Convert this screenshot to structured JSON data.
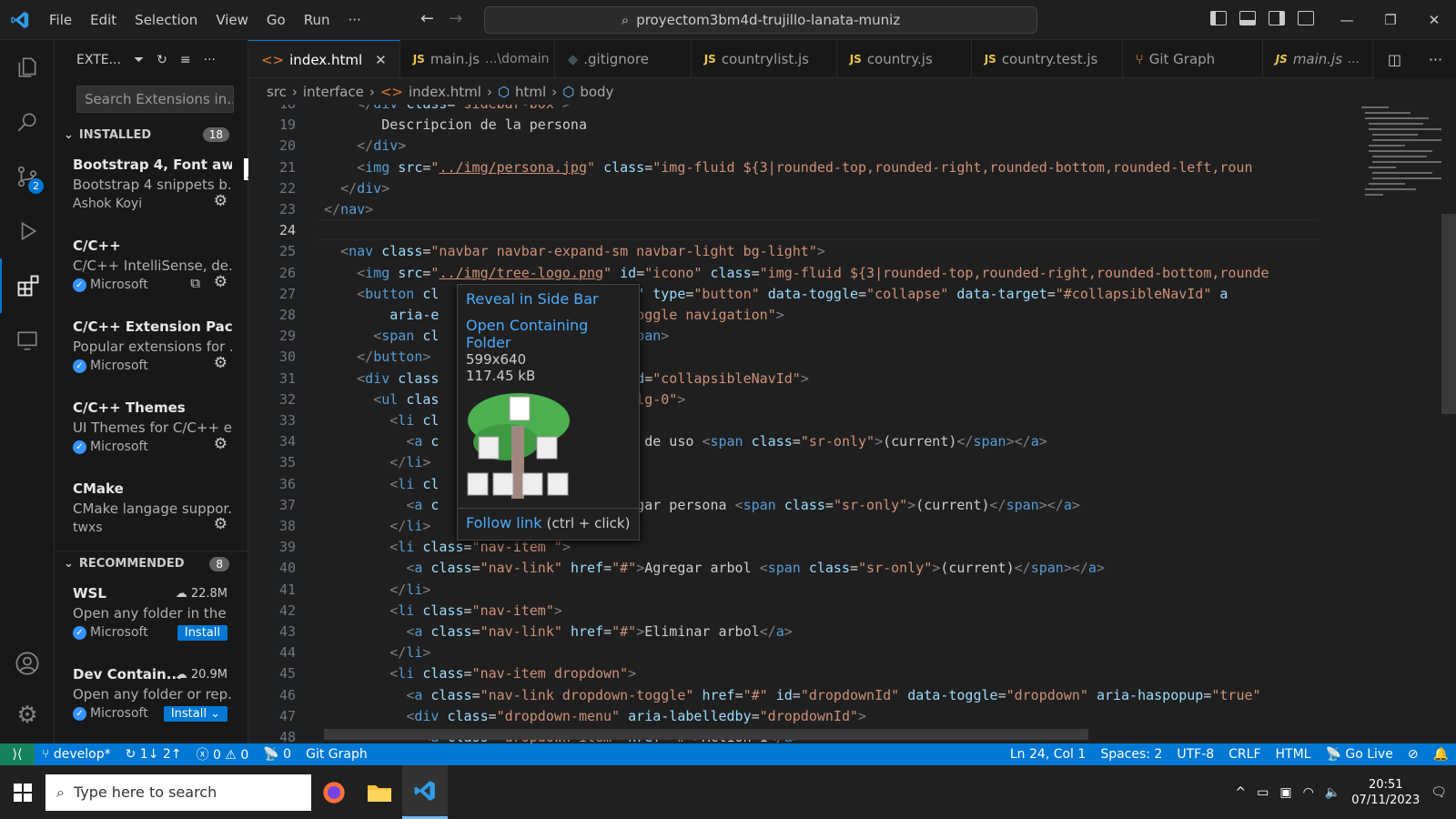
{
  "menu": [
    "File",
    "Edit",
    "Selection",
    "View",
    "Go",
    "Run",
    "···"
  ],
  "command_center": "proyectom3bm4d-trujillo-lanata-muniz",
  "sidebar": {
    "title": "EXTE...",
    "search_placeholder": "Search Extensions in...",
    "installed_label": "INSTALLED",
    "installed_count": "18",
    "recommended_label": "RECOMMENDED",
    "recommended_count": "8",
    "installed": [
      {
        "name": "Bootstrap 4, Font aw...",
        "desc": "Bootstrap 4 snippets b...",
        "publisher": "Ashok Koyi"
      },
      {
        "name": "C/C++",
        "desc": "C/C++ IntelliSense, de...",
        "publisher": "Microsoft"
      },
      {
        "name": "C/C++ Extension Pack",
        "desc": "Popular extensions for ...",
        "publisher": "Microsoft"
      },
      {
        "name": "C/C++ Themes",
        "desc": "UI Themes for C/C++ e...",
        "publisher": "Microsoft"
      },
      {
        "name": "CMake",
        "desc": "CMake langage suppor...",
        "publisher": "twxs"
      }
    ],
    "recommended": [
      {
        "name": "WSL",
        "desc": "Open any folder in the ...",
        "publisher": "Microsoft",
        "downloads": "22.8M",
        "action": "Install"
      },
      {
        "name": "Dev Contain...",
        "desc": "Open any folder or rep...",
        "publisher": "Microsoft",
        "downloads": "20.9M",
        "action": "Install"
      }
    ]
  },
  "source_control_badge": "2",
  "tabs": [
    {
      "label": "index.html",
      "desc": "",
      "kind": "html"
    },
    {
      "label": "main.js",
      "desc": "...\\domain",
      "kind": "js"
    },
    {
      "label": ".gitignore",
      "desc": "",
      "kind": "git"
    },
    {
      "label": "countrylist.js",
      "desc": "",
      "kind": "js"
    },
    {
      "label": "country.js",
      "desc": "",
      "kind": "js"
    },
    {
      "label": "country.test.js",
      "desc": "",
      "kind": "js"
    },
    {
      "label": "Git Graph",
      "desc": "",
      "kind": "graph"
    },
    {
      "label": "main.js",
      "desc": "...",
      "kind": "js"
    }
  ],
  "breadcrumb": [
    "src",
    "interface",
    "index.html",
    "html",
    "body"
  ],
  "line_numbers": [
    "18",
    "19",
    "20",
    "21",
    "22",
    "23",
    "24",
    "25",
    "26",
    "27",
    "28",
    "29",
    "30",
    "31",
    "32",
    "33",
    "34",
    "35",
    "36",
    "37",
    "38",
    "39",
    "40",
    "41",
    "42",
    "43",
    "44",
    "45",
    "46",
    "47",
    "48"
  ],
  "hover": {
    "reveal": "Reveal in Side Bar",
    "open_folder": "Open Containing Folder",
    "dimensions": "599x640",
    "size": "117.45 kB",
    "follow": "Follow link",
    "follow_hint": "(ctrl + click)"
  },
  "status": {
    "branch": "develop*",
    "sync": "1↓ 2↑",
    "errors": "0",
    "warnings": "0",
    "ports": "0",
    "gitgraph": "Git Graph",
    "position": "Ln 24, Col 1",
    "spaces": "Spaces: 2",
    "encoding": "UTF-8",
    "eol": "CRLF",
    "language": "HTML",
    "golive": "Go Live"
  },
  "taskbar": {
    "search_placeholder": "Type here to search",
    "time": "20:51",
    "date": "07/11/2023"
  }
}
